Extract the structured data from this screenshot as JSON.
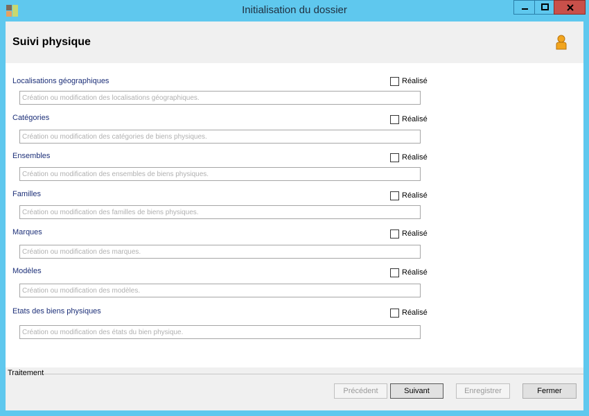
{
  "window": {
    "title": "Initialisation du dossier"
  },
  "header": {
    "title": "Suivi physique"
  },
  "sections": [
    {
      "label": "Localisations géographiques",
      "checkbox_label": "Réalisé",
      "checked": false,
      "placeholder": "Création ou modification des localisations géographiques."
    },
    {
      "label": "Catégories",
      "checkbox_label": "Réalisé",
      "checked": false,
      "placeholder": "Création ou modification des catégories de biens physiques."
    },
    {
      "label": "Ensembles",
      "checkbox_label": "Réalisé",
      "checked": false,
      "placeholder": "Création ou modification des ensembles de biens physiques."
    },
    {
      "label": "Familles",
      "checkbox_label": "Réalisé",
      "checked": false,
      "placeholder": "Création ou modification des familles de biens physiques."
    },
    {
      "label": "Marques",
      "checkbox_label": "Réalisé",
      "checked": false,
      "placeholder": "Création ou modification des marques."
    },
    {
      "label": "Modèles",
      "checkbox_label": "Réalisé",
      "checked": false,
      "placeholder": "Création ou modification des modèles."
    },
    {
      "label": "Etats des biens physiques",
      "checkbox_label": "Réalisé",
      "checked": false,
      "placeholder": "Création ou modification des états du bien physique."
    }
  ],
  "footer": {
    "group_label": "Traitement",
    "buttons": {
      "previous": "Précédent",
      "next": "Suivant",
      "save": "Enregistrer",
      "close": "Fermer"
    }
  },
  "colors": {
    "titlebar": "#5fc8ee",
    "section_label": "#1c2f78",
    "close_button": "#c9504a"
  },
  "icons": {
    "app": "app-icon",
    "user": "user-icon"
  }
}
